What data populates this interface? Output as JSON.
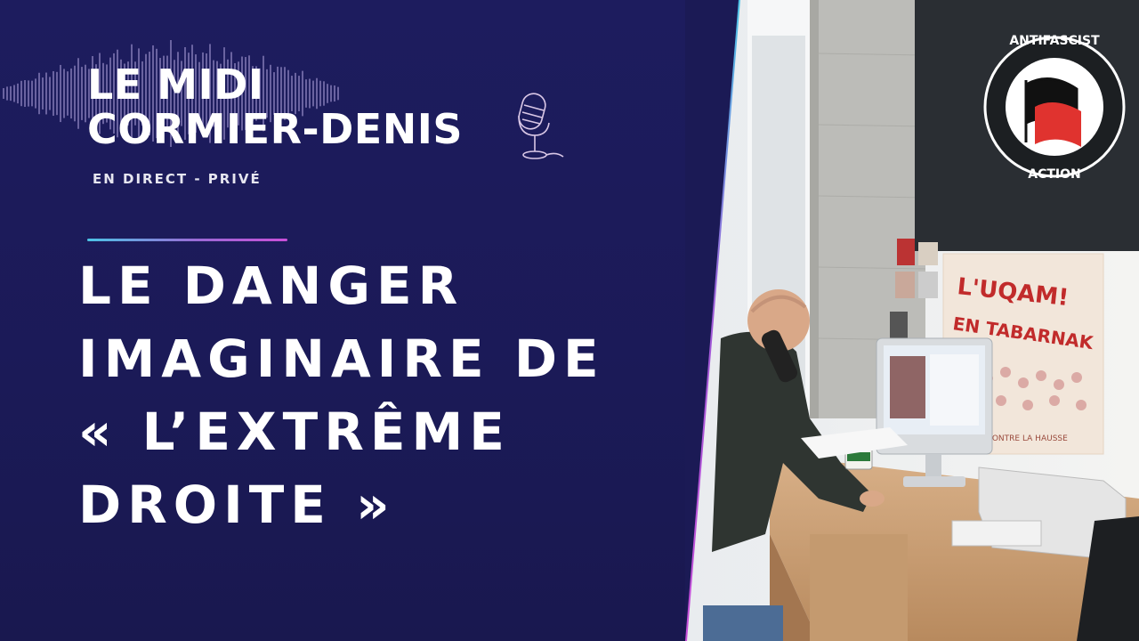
{
  "show": {
    "title_line1": "LE MIDI",
    "title_line2": "CORMIER-DENIS",
    "subtitle": "EN DIRECT - PRIVÉ"
  },
  "headline": {
    "line1": "LE DANGER",
    "line2": "IMAGINAIRE DE",
    "line3": "« L’EXTRÊME",
    "line4": "DROITE »"
  },
  "photo": {
    "flag_text_top": "ANTIFASCIST",
    "flag_text_bottom": "ACTION",
    "poster_line1": "L'UQAM!",
    "poster_line2": "EN TABARNAK",
    "poster_footer": "E CONTRE LA HAUSSE"
  },
  "colors": {
    "background": "#1b1a55",
    "accent_cyan": "#4cc4e6",
    "accent_magenta": "#c94fd9",
    "text": "#ffffff"
  }
}
